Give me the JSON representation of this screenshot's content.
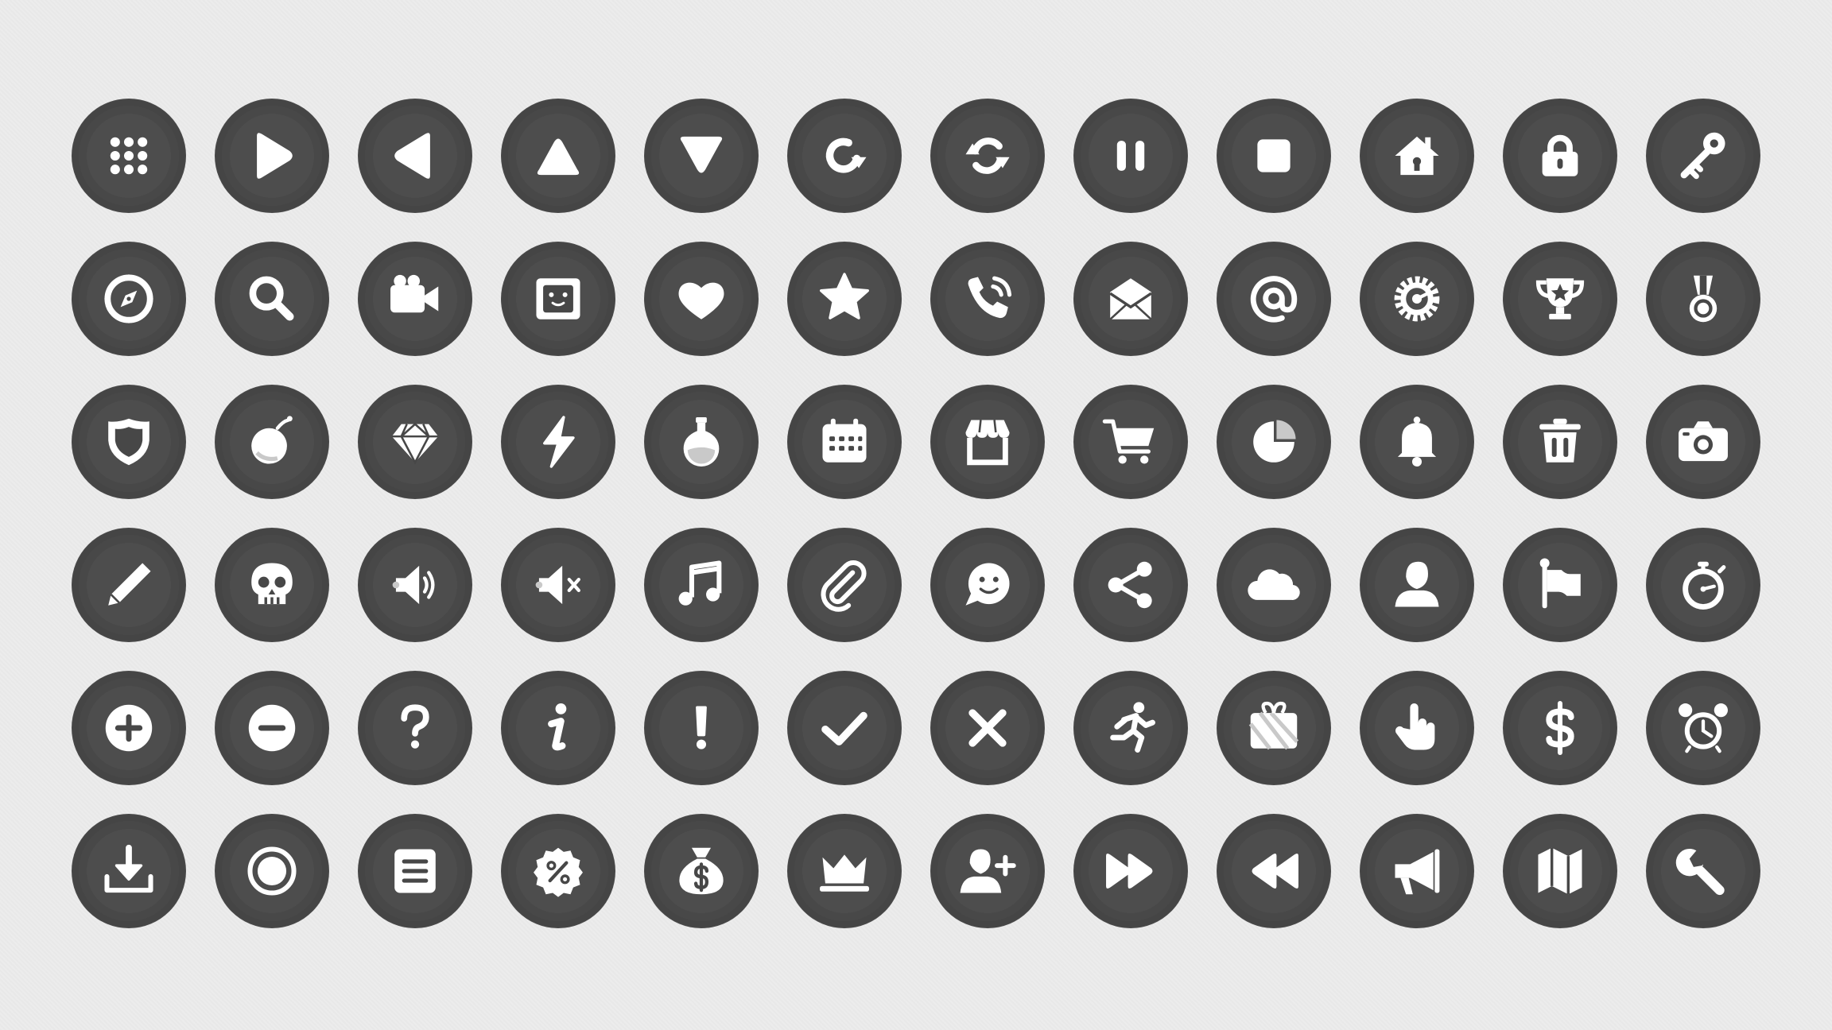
{
  "theme": {
    "background": "#ececec",
    "button": "#474747",
    "glyph": "#ffffff",
    "glyph_shadow": "#c9c9c9"
  },
  "icons": [
    "grid-menu-icon",
    "play-icon",
    "back-triangle-icon",
    "up-triangle-icon",
    "down-triangle-icon",
    "restart-icon",
    "refresh-icon",
    "pause-icon",
    "stop-icon",
    "home-icon",
    "lock-icon",
    "key-icon",
    "compass-icon",
    "search-icon",
    "video-camera-icon",
    "picture-frame-icon",
    "heart-icon",
    "star-icon",
    "phone-call-icon",
    "mail-open-icon",
    "at-sign-icon",
    "settings-gear-icon",
    "trophy-icon",
    "medal-icon",
    "shield-icon",
    "bomb-icon",
    "diamond-icon",
    "lightning-icon",
    "potion-icon",
    "calendar-icon",
    "shop-icon",
    "shopping-cart-icon",
    "pie-chart-icon",
    "bell-icon",
    "trash-icon",
    "camera-icon",
    "pencil-icon",
    "skull-icon",
    "volume-on-icon",
    "volume-mute-icon",
    "music-note-icon",
    "paperclip-icon",
    "emoji-chat-icon",
    "share-icon",
    "cloud-icon",
    "user-icon",
    "flag-icon",
    "stopwatch-icon",
    "plus-icon",
    "minus-icon",
    "question-icon",
    "info-icon",
    "exclamation-icon",
    "check-icon",
    "close-icon",
    "running-man-icon",
    "gift-icon",
    "hand-pointer-icon",
    "dollar-icon",
    "alarm-clock-icon",
    "download-icon",
    "radio-button-icon",
    "document-list-icon",
    "discount-icon",
    "money-bag-icon",
    "crown-icon",
    "add-user-icon",
    "fast-forward-icon",
    "rewind-icon",
    "megaphone-icon",
    "map-icon",
    "wrench-icon"
  ]
}
